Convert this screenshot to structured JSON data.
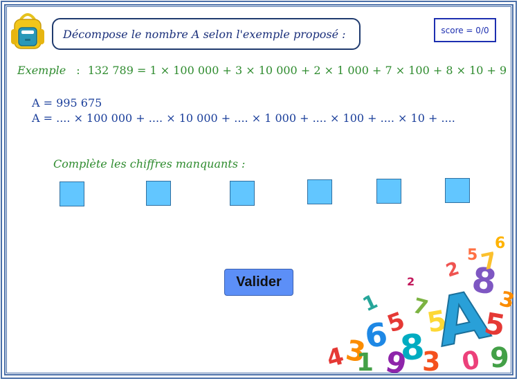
{
  "title": "Décompose le nombre A selon l'exemple proposé :",
  "score": "score = 0/0",
  "example": {
    "label": "Exemple",
    "separator": ":",
    "expression": "132 789 = 1 × 100 000 + 3 × 10 000 + 2 × 1 000 + 7 × 100 + 8 × 10 + 9"
  },
  "problem": {
    "line1": "A = 995 675",
    "line2": "A = .... × 100 000 + .... × 10 000 + .... × 1 000  + .... × 100 + .... × 10  + ...."
  },
  "instruction": "Complète les chiffres manquants :",
  "answer_boxes": [
    "",
    "",
    "",
    "",
    "",
    ""
  ],
  "button": {
    "validate_label": "Valider"
  },
  "icons": {
    "logo": "backpack-icon",
    "decoration": "numbers-pile-image"
  },
  "colors": {
    "frame": "#4a6fa8",
    "title": "#1a2f7a",
    "example": "#2e8b2e",
    "problem": "#1a3e9a",
    "answer_box": "#62c6ff",
    "button": "#5c8ff7"
  }
}
